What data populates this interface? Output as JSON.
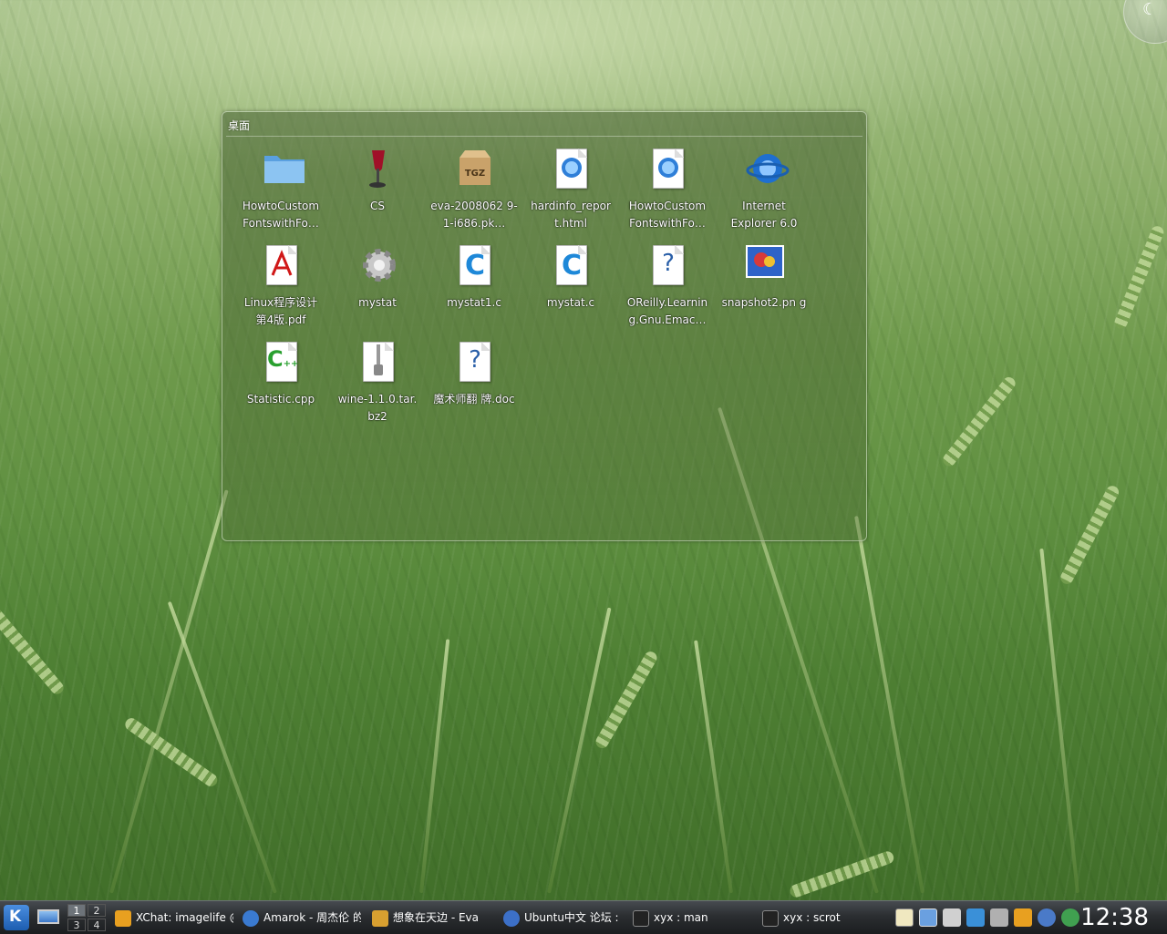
{
  "desktop": {
    "folder_view": {
      "title": "桌面",
      "icons": [
        {
          "label": "HowtoCustom FontswithFo…",
          "icon": "folder-icon"
        },
        {
          "label": "CS",
          "icon": "wine-glass-icon"
        },
        {
          "label": "eva-2008062 9-1-i686.pk…",
          "icon": "tgz-archive-icon"
        },
        {
          "label": "hardinfo_repor t.html",
          "icon": "html-document-icon"
        },
        {
          "label": "HowtoCustom FontswithFo…",
          "icon": "html-document-icon"
        },
        {
          "label": "Internet Explorer 6.0",
          "icon": "internet-explorer-icon"
        },
        {
          "label": "Linux程序设计 第4版.pdf",
          "icon": "pdf-document-icon"
        },
        {
          "label": "mystat",
          "icon": "gear-icon"
        },
        {
          "label": "mystat1.c",
          "icon": "c-source-icon"
        },
        {
          "label": "mystat.c",
          "icon": "c-source-icon"
        },
        {
          "label": "OReilly.Learnin g.Gnu.Emac…",
          "icon": "unknown-document-icon"
        },
        {
          "label": "snapshot2.pn g",
          "icon": "png-image-icon"
        },
        {
          "label": "Statistic.cpp",
          "icon": "cpp-source-icon"
        },
        {
          "label": "wine-1.1.0.tar. bz2",
          "icon": "zip-archive-icon"
        },
        {
          "label": "魔术师翻 牌.doc",
          "icon": "unknown-document-icon"
        }
      ]
    }
  },
  "taskbar": {
    "pager": [
      "1",
      "2",
      "3",
      "4"
    ],
    "tasks": [
      {
        "label": "XChat: imagelife @",
        "icon": "xchat-icon"
      },
      {
        "label": "Amarok - 周杰伦 的",
        "icon": "amarok-icon"
      },
      {
        "label": "想象在天边 - Eva",
        "icon": "eva-icon"
      },
      {
        "label": "Ubuntu中文 论坛 :",
        "icon": "browser-icon"
      },
      {
        "label": "xyx : man",
        "icon": "terminal-icon"
      },
      {
        "label": "xyx : scrot",
        "icon": "terminal-icon"
      }
    ],
    "tray": [
      "clipboard-icon",
      "display-icon",
      "volume-icon",
      "network-icon",
      "printer-icon",
      "xchat-tray-icon",
      "update-icon",
      "chat-tray-icon"
    ],
    "clock": "12:38"
  },
  "colors": {
    "taskbar": "#2b2e31",
    "panel_border": "#e6f0dc",
    "text": "#ffffff"
  }
}
